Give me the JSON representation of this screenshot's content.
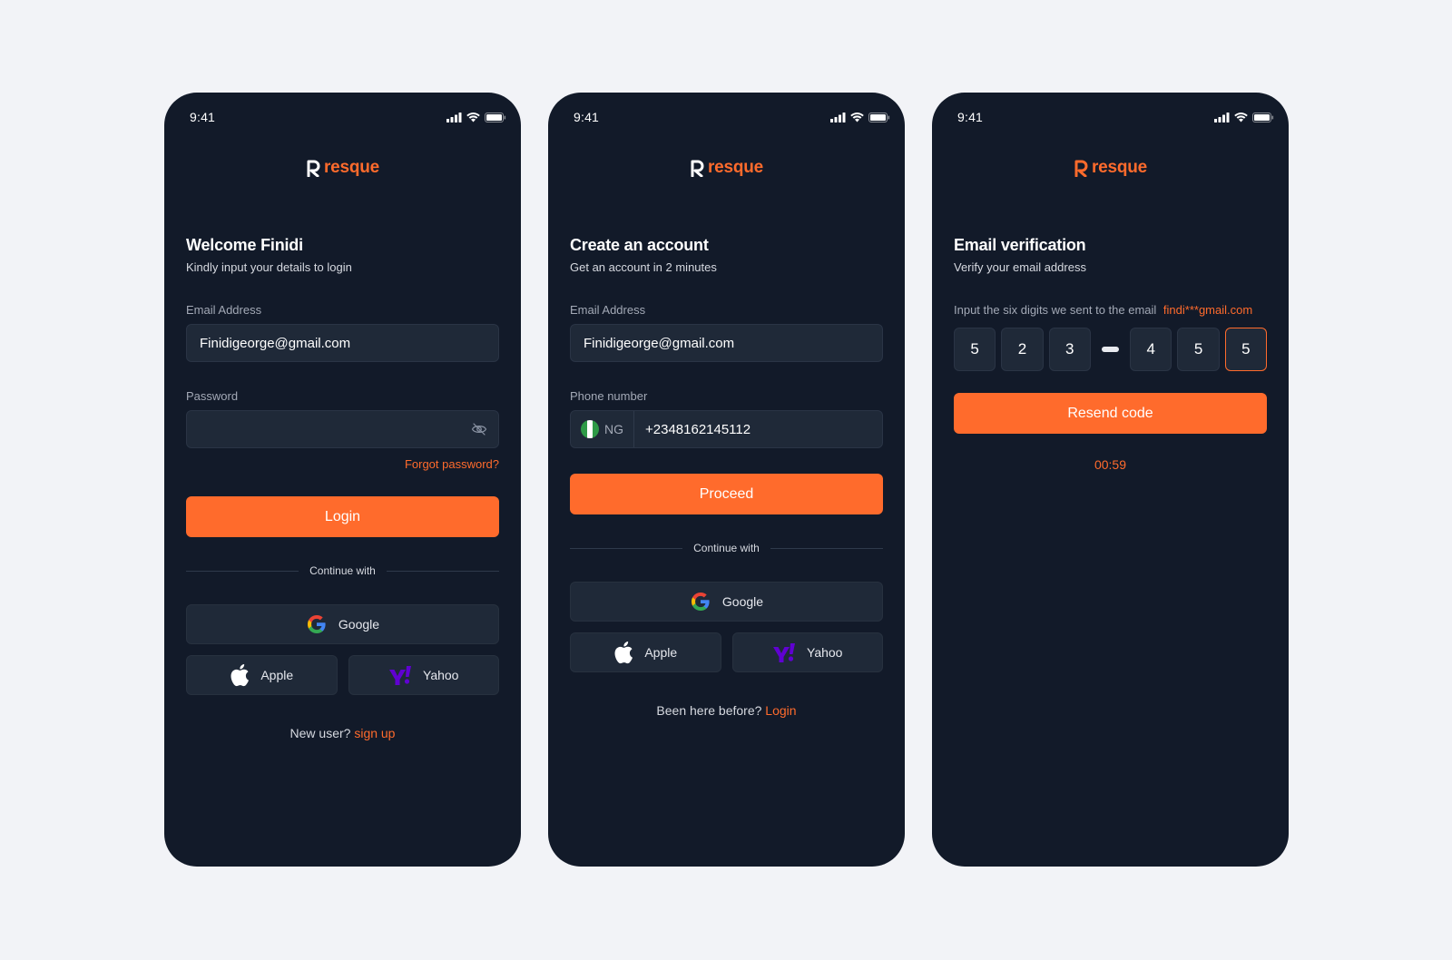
{
  "colors": {
    "accent": "#ff6b2c",
    "phone_bg": "#121a29",
    "input_bg": "#1f2938",
    "page_bg": "#f2f3f7"
  },
  "status_bar": {
    "time": "9:41"
  },
  "brand": {
    "name": "resque"
  },
  "login": {
    "title": "Welcome Finidi",
    "subtitle": "Kindly input your details to login",
    "email_label": "Email Address",
    "email_value": "Finidigeorge@gmail.com",
    "password_label": "Password",
    "forgot_password": "Forgot password?",
    "login_button": "Login",
    "continue_with": "Continue with",
    "google": "Google",
    "apple": "Apple",
    "yahoo": "Yahoo",
    "footer_text": "New user?",
    "footer_link": "sign up"
  },
  "signup": {
    "title": "Create an account",
    "subtitle": "Get an account in 2 minutes",
    "email_label": "Email Address",
    "email_value": "Finidigeorge@gmail.com",
    "phone_label": "Phone number",
    "country_code": "NG",
    "phone_value": "+2348162145112",
    "proceed_button": "Proceed",
    "continue_with": "Continue with",
    "google": "Google",
    "apple": "Apple",
    "yahoo": "Yahoo",
    "footer_text": "Been here before?",
    "footer_link": "Login"
  },
  "verify": {
    "title": "Email verification",
    "subtitle": "Verify your email address",
    "hint": "Input the six digits we sent to the email",
    "masked_email": "findi***gmail.com",
    "digits": [
      "5",
      "2",
      "3",
      "4",
      "5",
      "5"
    ],
    "resend_button": "Resend code",
    "timer": "00:59"
  }
}
